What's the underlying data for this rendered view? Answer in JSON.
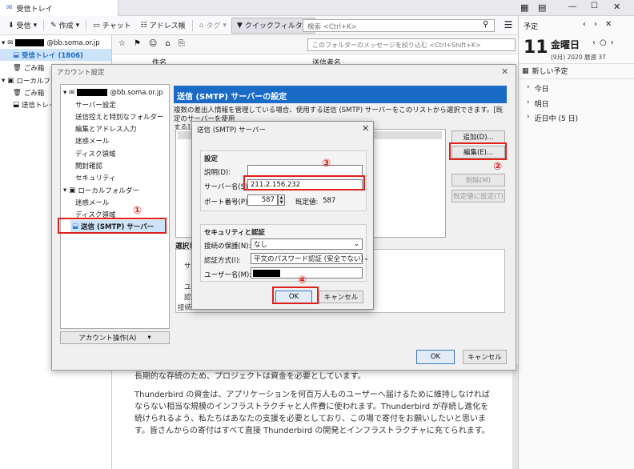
{
  "app": {
    "tab_title": "受信トレイ"
  },
  "toolbar": {
    "get_mail": "受信",
    "write": "作成",
    "chat": "チャット",
    "address_book": "アドレス帳",
    "tag": "タグ",
    "quick_filter": "クイックフィルター",
    "search_placeholder": "検索 <Ctrl+K>"
  },
  "folders": {
    "account_suffix": "@bb.soma.or.jp",
    "inbox": "受信トレイ (1806)",
    "trash": "ごみ箱",
    "local_folders": "ローカルフォル",
    "local_trash": "ごみ箱",
    "local_sent": "送信トレイ"
  },
  "message_list": {
    "filter_placeholder": "このフォルダーのメッセージを絞り込む <Ctrl+Shift+K>",
    "col_subject": "件名",
    "col_sender": "送信者名"
  },
  "right_pane": {
    "header": "予定",
    "day": "11",
    "weekday": "金曜日",
    "date_sub": "(9月) 2020 暦週 37",
    "new_event": "新しい予定",
    "today": "今日",
    "tomorrow": "明日",
    "upcoming": "近日中 (5 日)"
  },
  "account_settings": {
    "title": "アカウント設定",
    "account_suffix": "@bb.soma.or.jp",
    "items": [
      "サーバー設定",
      "送信控えと特別なフォルダー",
      "編集とアドレス入力",
      "迷惑メール",
      "ディスク領域",
      "開封確認",
      "セキュリティ"
    ],
    "local_folders": "ローカルフォルダー",
    "local_items": [
      "迷惑メール",
      "ディスク領域"
    ],
    "smtp_item": "送信 (SMTP) サーバー",
    "account_ops": "アカウント操作(A)",
    "smtp_header": "送信 (SMTP) サーバーの設定",
    "smtp_desc_1": "複数の差出人情報を管理している場合、使用する送信 (SMTP) サーバーをこのリストから選択できます。[既定のサーバーを使用",
    "smtp_desc_2": "する] を選択すると、このリストの既定のサーバーを使用します。",
    "add": "追加(D)...",
    "edit": "編集(E)...",
    "remove": "削除(M)",
    "set_default": "既定値に設定(T)",
    "detail_label": "選択し",
    "detail_lines": [
      "サー",
      "ユー",
      "認証",
      "接続"
    ],
    "ok": "OK",
    "cancel": "キャンセル"
  },
  "smtp_dialog": {
    "title": "送信 (SMTP) サーバー",
    "settings": "設定",
    "description": "説明(D):",
    "server_name": "サーバー名(S):",
    "server_value": "211.2.156.232",
    "port": "ポート番号(P):",
    "port_value": "587",
    "default_label": "既定値:",
    "default_value": "587",
    "security_group": "セキュリティと認証",
    "conn_security": "接続の保護(N):",
    "conn_value": "なし",
    "auth_method": "認証方式(I):",
    "auth_value": "平文のパスワード認証 (安全でない)",
    "username": "ユーザー名(M):",
    "ok": "OK",
    "cancel": "キャンセル"
  },
  "annotations": [
    "①",
    "②",
    "③",
    "④"
  ],
  "content": {
    "line1": "長期的な存続のため、プロジェクトは資金を必要としています。",
    "para2": "Thunderbird の資金は、アプリケーションを何百万人ものユーザーへ届けるために維持しなければならない相当な規模のインフラストラクチャと人件費に使われます。Thunderbird が存続し進化を続けられるよう、私たちはあなたの支援を必要としており、この場で寄付をお願いしたいと思います。皆さんからの寄付はすべて直接 Thunderbird の開発とインフラストラクチャに充てられます。"
  },
  "colors": {
    "accent": "#1a6bc6",
    "highlight_red": "#e0201c",
    "selection": "#cde3f7"
  }
}
